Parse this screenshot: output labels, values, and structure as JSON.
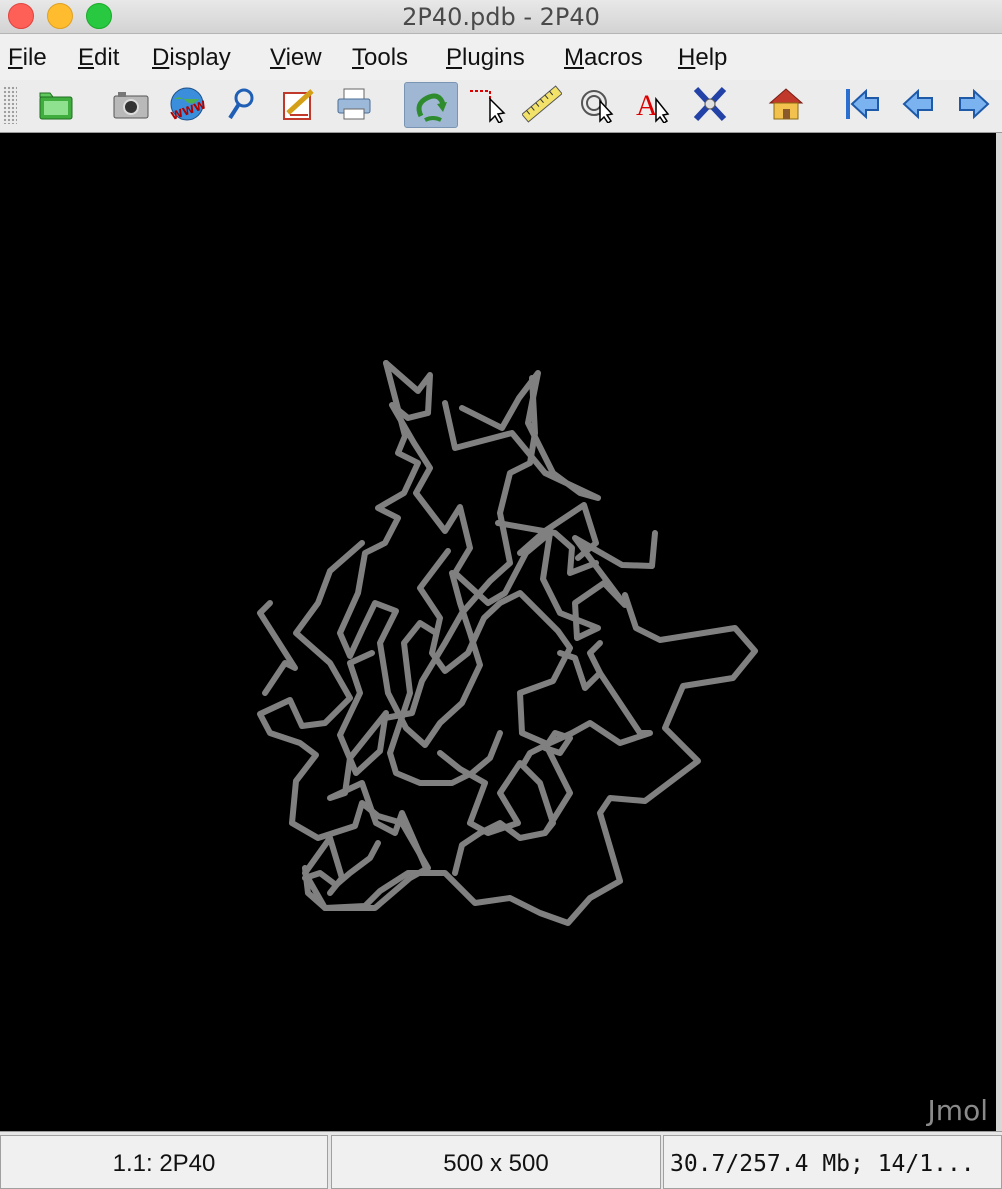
{
  "window": {
    "title": "2P40.pdb - 2P40"
  },
  "menu": [
    "File",
    "Edit",
    "Display",
    "View",
    "Tools",
    "Plugins",
    "Macros",
    "Help"
  ],
  "toolbar": {
    "buttons": [
      {
        "name": "open-file-button",
        "icon": "folder-icon"
      },
      {
        "name": "export-image-button",
        "icon": "camera-icon"
      },
      {
        "name": "open-url-button",
        "icon": "www-globe-icon"
      },
      {
        "name": "script-button",
        "icon": "magnifier-icon"
      },
      {
        "name": "editor-button",
        "icon": "pencil-icon"
      },
      {
        "name": "print-button",
        "icon": "printer-icon"
      },
      {
        "name": "rotate-button",
        "icon": "rotate-arrow-icon",
        "active": true
      },
      {
        "name": "pick-button",
        "icon": "pointer-icon"
      },
      {
        "name": "measure-button",
        "icon": "ruler-icon"
      },
      {
        "name": "spin-pick-button",
        "icon": "target-pointer-icon"
      },
      {
        "name": "label-pick-button",
        "icon": "a-pointer-icon"
      },
      {
        "name": "atom-set-button",
        "icon": "molecule-icon"
      },
      {
        "name": "home-button",
        "icon": "home-icon"
      },
      {
        "name": "first-frame-button",
        "icon": "first-arrow-icon"
      },
      {
        "name": "prev-frame-button",
        "icon": "left-arrow-icon"
      },
      {
        "name": "next-frame-button",
        "icon": "right-arrow-icon"
      }
    ]
  },
  "viewer": {
    "watermark": "Jmol",
    "background": "#000000",
    "trace_color": "#808080"
  },
  "status": {
    "model": "1.1: 2P40",
    "size": "500 x 500",
    "memory": "30.7/257.4 Mb;  14/1..."
  }
}
